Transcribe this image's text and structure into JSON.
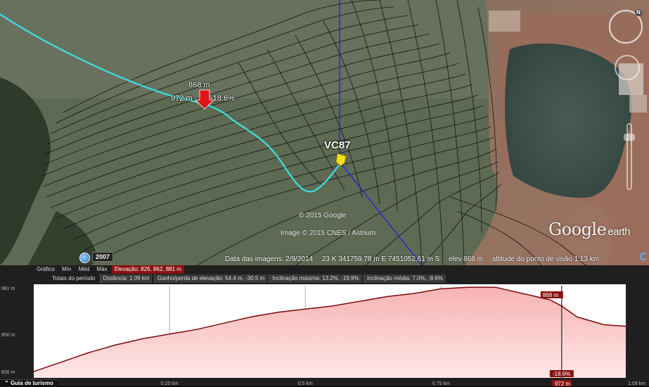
{
  "map": {
    "placemark": {
      "elevation_label": "868 m",
      "distance_label": "972 m",
      "slope_label": "-18.6%"
    },
    "poi_label": "VC87",
    "copyright_google": "© 2015 Google",
    "copyright_image": "Image © 2015 CNES / Astrium",
    "logo_text": "Google",
    "logo_suffix": "earth",
    "history_year": "2007",
    "status": {
      "imagery_date": "Data das imagens: 2/9/2014",
      "coordinates": "23 K 341759.78 m E 7451052.61 m S",
      "elevation": "elev 868 m",
      "eye_altitude": "altitude do ponto de visão 1.13 km"
    },
    "colors": {
      "path": "#3fd9d9",
      "cursor_line": "#1a1af0",
      "placemark_red": "#e01414",
      "poi_yellow": "#f2e01a"
    },
    "icons": [
      "compass-icon",
      "look-control-icon",
      "zoom-slider-icon",
      "history-icon",
      "refresh-icon"
    ]
  },
  "profile": {
    "row1": {
      "graph_label": "Gráfico",
      "min": "Mín",
      "med": "Méd",
      "max": "Máx",
      "elevation_summary": "Elevação: 826, 862, 881 m"
    },
    "row2": {
      "totals_label": "Totais do período",
      "distance": "Distância: 1.09 km",
      "gain_loss": "Ganho/perda de elevação: 54.4 m, -30.5 m",
      "max_slope": "Inclinação máxima: 13.2%, -19.9%",
      "avg_slope": "Inclinação média: 7.0%, -9.6%"
    },
    "cursor_elevation": "868 m",
    "cursor_slope": "-18.6%",
    "cursor_distance": "972 m",
    "colors": {
      "fill_top": "#f7b3b3",
      "fill_bottom": "#ffe6e6",
      "line": "#7a0a0a",
      "badge": "#8a1212"
    }
  },
  "tour_tab_label": "Guia de turismo",
  "chart_data": {
    "type": "area",
    "title": "",
    "xlabel": "",
    "ylabel": "",
    "x_ticks": [
      "0.25 km",
      "0.5 km",
      "0.75 km",
      "1.09 km"
    ],
    "y_ticks": [
      "881 m",
      "850 m",
      "826 m"
    ],
    "xlim": [
      0,
      1.09
    ],
    "ylim": [
      822,
      881
    ],
    "grid": true,
    "series": [
      {
        "x": [
          0,
          0.05,
          0.1,
          0.15,
          0.2,
          0.25,
          0.3,
          0.35,
          0.4,
          0.45,
          0.5,
          0.55,
          0.6,
          0.65,
          0.7,
          0.75,
          0.8,
          0.85,
          0.9,
          0.95,
          0.972,
          1.0,
          1.05,
          1.09
        ],
        "y": [
          826,
          832,
          838,
          843,
          847,
          850,
          853,
          857,
          861,
          864,
          866,
          868,
          871,
          874,
          876,
          879,
          880,
          880,
          876,
          872,
          868,
          861,
          856,
          855
        ]
      }
    ],
    "cursor_x": 0.972
  }
}
